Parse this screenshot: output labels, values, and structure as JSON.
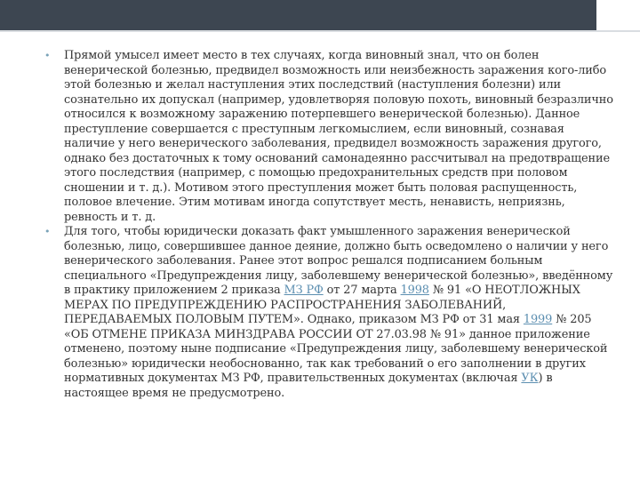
{
  "slide": {
    "colors": {
      "top_bar": "#3d4651",
      "bullet": "#7aa3b8",
      "text": "#333333",
      "link": "#5b8eb0"
    },
    "bullets": [
      {
        "text": "Прямой умысел имеет место в тех случаях, когда виновный знал, что он болен венерической болезнью, предвидел возможность или неизбежность заражения кого-либо этой болезнью и желал наступления этих последствий (наступления болезни) или сознательно их допускал (например, удовлетворяя половую похоть, виновный безразлично относился к возможному заражению потерпевшего венерической болезнью). Данное преступление совершается с преступным легкомыслием, если виновный, сознавая наличие у него венерического заболевания, предвидел возможность заражения другого, однако без достаточных к тому оснований самонадеянно рассчитывал на предотвращение этого последствия (например, с помощью предохранительных средств при половом сношении и т. д.). Мотивом этого преступления может быть половая распущенность, половое влечение. Этим мотивам иногда сопутствует месть, ненависть, неприязнь, ревность и т. д."
      },
      {
        "parts": [
          "Для того, чтобы юридически доказать факт умышленного заражения венерической болезнью, лицо, совершившее данное деяние, должно быть осведомлено о наличии у него венерического заболевания. Ранее этот вопрос решался подписанием больным специального «Предупреждения лицу, заболевшему венерической болезнью», введённому в практику приложением 2 приказа ",
          "МЗ РФ",
          " от 27 марта ",
          "1998",
          " № 91 «О НЕОТЛОЖНЫХ МЕРАХ ПО ПРЕДУПРЕЖДЕНИЮ РАСПРОСТРАНЕНИЯ ЗАБОЛЕВАНИЙ, ПЕРЕДАВАЕМЫХ ПОЛОВЫМ ПУТЕМ». Однако, приказом МЗ РФ от 31 мая ",
          "1999",
          " № 205 «ОБ ОТМЕНЕ ПРИКАЗА МИНЗДРАВА РОССИИ ОТ 27.03.98 № 91» данное приложение отменено, поэтому ныне подписание «Предупреждения лицу, заболевшему венерической болезнью» юридически необоснованно, так как требований о его заполнении в других нормативных документах МЗ РФ, правительственных документах (включая ",
          "УК",
          ") в настоящее время не предусмотрено."
        ]
      }
    ]
  }
}
